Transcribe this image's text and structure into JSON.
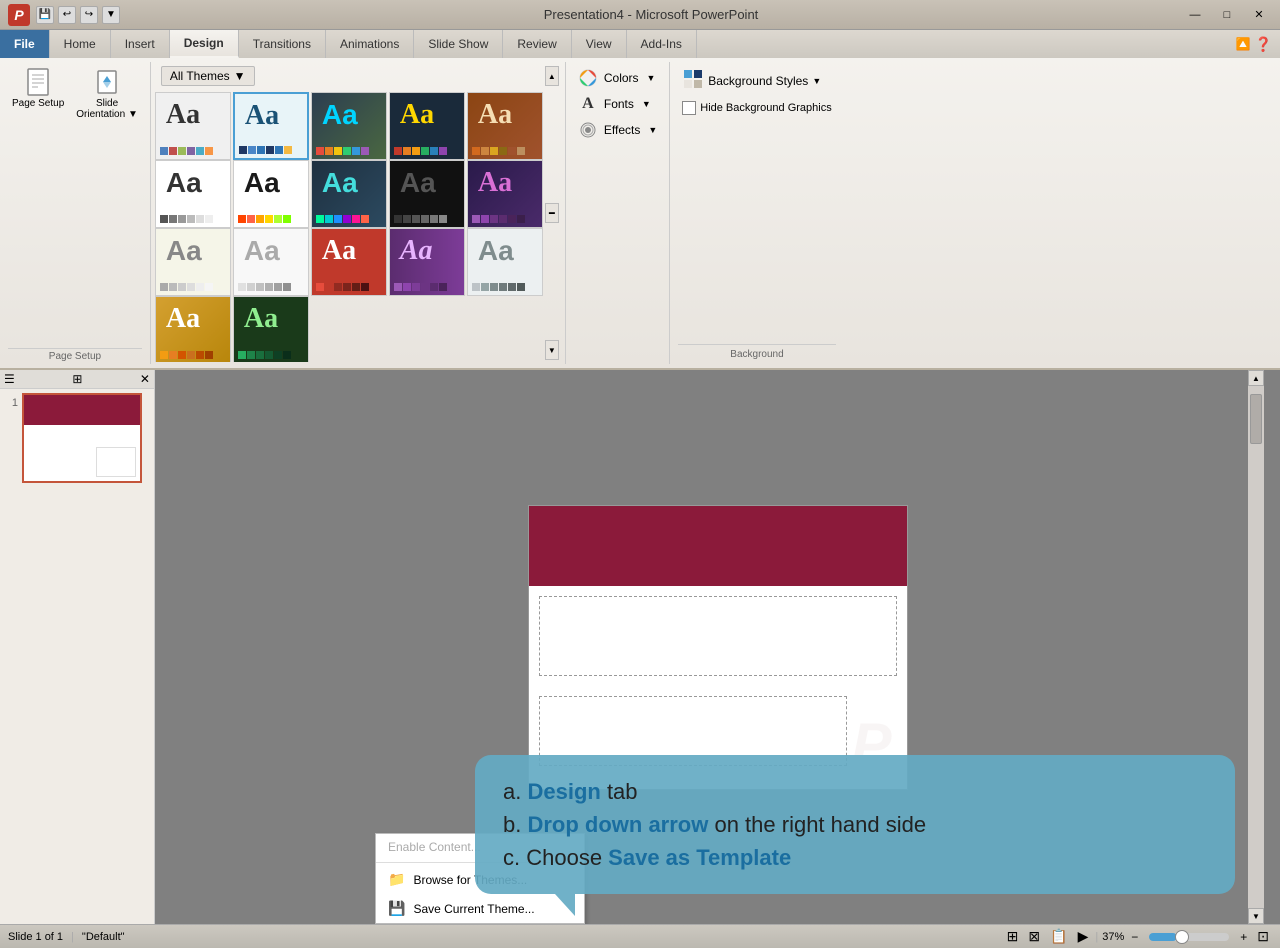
{
  "titlebar": {
    "title": "Presentation4 - Microsoft PowerPoint",
    "logo": "P",
    "buttons": {
      "minimize": "—",
      "maximize": "□",
      "close": "✕"
    }
  },
  "ribbon": {
    "tabs": [
      "File",
      "Home",
      "Insert",
      "Design",
      "Transitions",
      "Animations",
      "Slide Show",
      "Review",
      "View",
      "Add-Ins"
    ],
    "active_tab": "Design",
    "groups": {
      "page_setup": {
        "label": "Page Setup",
        "items": [
          "Page Setup",
          "Slide Orientation"
        ]
      },
      "themes": {
        "dropdown_label": "All Themes",
        "dropdown_arrow": "▼"
      },
      "customize": {
        "colors_label": "Colors",
        "fonts_label": "Fonts",
        "effects_label": "Effects",
        "colors_arrow": "▼",
        "fonts_arrow": "▼",
        "effects_arrow": "▼"
      },
      "background": {
        "bg_styles_label": "Background Styles",
        "hide_bg_label": "Hide Background Graphics",
        "group_label": "Background"
      }
    }
  },
  "themes": [
    {
      "bg": "#f0f0f0",
      "text": "#333",
      "colors": [
        "#4f81bd",
        "#c0504d",
        "#9bbb59",
        "#8064a2",
        "#4bacc6",
        "#f79646"
      ]
    },
    {
      "bg": "#e8f4f8",
      "text": "#1a5276",
      "colors": [
        "#1f3864",
        "#4a86c8",
        "#2e74b5",
        "#203864",
        "#2e75b6",
        "#f4b942"
      ]
    },
    {
      "bg": "#2c3e50",
      "text": "#ecf0f1",
      "colors": [
        "#e74c3c",
        "#e67e22",
        "#f1c40f",
        "#2ecc71",
        "#3498db",
        "#9b59b6"
      ]
    },
    {
      "bg": "#1a2a3a",
      "text": "#ffd700",
      "colors": [
        "#c0392b",
        "#e67e22",
        "#f39c12",
        "#27ae60",
        "#2980b9",
        "#8e44ad"
      ]
    },
    {
      "bg": "#8b4513",
      "text": "#f5deb3",
      "colors": [
        "#d2691e",
        "#cd853f",
        "#daa520",
        "#8b6914",
        "#a0522d",
        "#bc8f5f"
      ]
    },
    {
      "bg": "#1c1c1c",
      "text": "#cccccc",
      "colors": [
        "#555",
        "#777",
        "#999",
        "#bbb",
        "#ddd",
        "#eee"
      ]
    },
    {
      "bg": "#2d2d2d",
      "text": "#ff8c00",
      "colors": [
        "#ff4500",
        "#ff6347",
        "#ffa500",
        "#ffd700",
        "#adff2f",
        "#7fff00"
      ]
    },
    {
      "bg": "#0a0a2a",
      "text": "#00ff7f",
      "colors": [
        "#00fa9a",
        "#00ced1",
        "#1e90ff",
        "#9400d3",
        "#ff1493",
        "#ff6347"
      ]
    },
    {
      "bg": "#fff",
      "text": "#000",
      "colors": [
        "#f00",
        "#fa0",
        "#ff0",
        "#0a0",
        "#00f",
        "#808"
      ]
    },
    {
      "bg": "#3a0050",
      "text": "#ff69b4",
      "colors": [
        "#9b59b6",
        "#8e44ad",
        "#6c3483",
        "#5b2c6f",
        "#4a235a",
        "#3b1f4b"
      ]
    },
    {
      "bg": "#f5f5e8",
      "text": "#888",
      "colors": [
        "#aaa",
        "#bbb",
        "#ccc",
        "#ddd",
        "#eee",
        "#f5f5f5"
      ]
    },
    {
      "bg": "#f8f8f8",
      "text": "#aaa",
      "colors": [
        "#e0e0e0",
        "#d0d0d0",
        "#c0c0c0",
        "#b0b0b0",
        "#a0a0a0",
        "#909090"
      ]
    },
    {
      "bg": "#c0392b",
      "text": "#fff",
      "colors": [
        "#e74c3c",
        "#c0392b",
        "#922b21",
        "#7b241c",
        "#641e16",
        "#4c1112"
      ]
    },
    {
      "bg": "#6c3483",
      "text": "#f8f0fc",
      "colors": [
        "#9b59b6",
        "#8e44ad",
        "#7d3c98",
        "#6c3483",
        "#5b2c6f",
        "#4a235a"
      ]
    },
    {
      "bg": "#ecf0f1",
      "text": "#7f8c8d",
      "colors": [
        "#bdc3c7",
        "#95a5a6",
        "#7f8c8d",
        "#707b7c",
        "#616a6b",
        "#515a5a"
      ]
    },
    {
      "bg": "#f0f0f0",
      "text": "#bbb",
      "colors": [
        "#ddd",
        "#ccc",
        "#bbb",
        "#aaa",
        "#999",
        "#888"
      ]
    },
    {
      "bg": "#ffd700",
      "text": "#333",
      "colors": [
        "#f39c12",
        "#e67e22",
        "#d35400",
        "#ca6f1e",
        "#ba4a00",
        "#a04000"
      ]
    },
    {
      "bg": "#1a3a1a",
      "text": "#90ee90",
      "colors": [
        "#27ae60",
        "#1e8449",
        "#196f3d",
        "#145a32",
        "#0e4024",
        "#0a2e1a"
      ]
    },
    {
      "bg": "#e8e8e8",
      "text": "#555",
      "colors": [
        "#aaa",
        "#999",
        "#888",
        "#777",
        "#666",
        "#555"
      ]
    },
    {
      "bg": "#f5e6d3",
      "text": "#8b4513",
      "colors": [
        "#d2691e",
        "#cd853f",
        "#daa520",
        "#c19a6b",
        "#a67c52",
        "#8b6914"
      ]
    }
  ],
  "slide": {
    "number": "1",
    "total": "1",
    "layout": "Default"
  },
  "tooltip": {
    "line_a_prefix": "a. ",
    "line_a_highlight": "Design",
    "line_a_rest": " tab",
    "line_b_prefix": "b. ",
    "line_b_highlight": "Drop down arrow",
    "line_b_rest": " on the right hand side",
    "line_c_prefix": "c. ",
    "line_c_rest": "Choose ",
    "line_c_highlight": "Save as Template"
  },
  "dropdown": {
    "enable_content": "Enable Content...",
    "browse_themes": "Browse for Themes...",
    "save_theme": "Save Current Theme..."
  },
  "status_bar": {
    "slide_info": "Slide 1 of 1",
    "theme": "Default",
    "zoom": "37%"
  },
  "icons": {
    "page_setup": "▭",
    "slide_orientation": "↕",
    "colors_icon": "🎨",
    "fonts_icon": "A",
    "effects_icon": "◉",
    "bg_styles_icon": "▦",
    "scroll_up": "▲",
    "scroll_down": "▼",
    "scroll_left": "◄",
    "scroll_right": "►"
  }
}
